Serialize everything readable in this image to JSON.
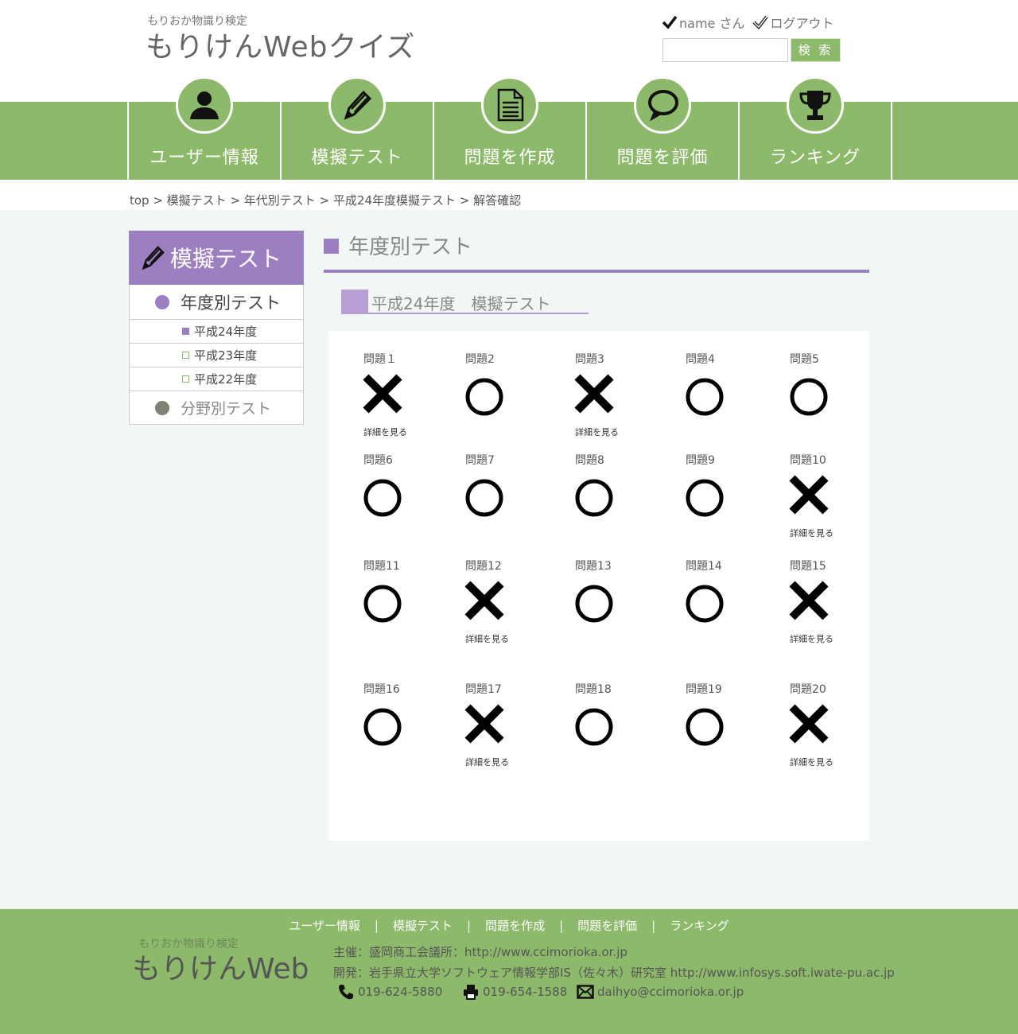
{
  "header": {
    "logo_sub": "もりおか物識り検定",
    "logo_main": "もりけんWebクイズ",
    "user_name": "name さん",
    "logout": "ログアウト",
    "search_placeholder": "",
    "search_button": "検 索"
  },
  "nav": [
    {
      "label": "ユーザー情報",
      "icon": "user-icon"
    },
    {
      "label": "模擬テスト",
      "icon": "pencil-icon"
    },
    {
      "label": "問題を作成",
      "icon": "document-icon"
    },
    {
      "label": "問題を評価",
      "icon": "speech-bubble-icon"
    },
    {
      "label": "ランキング",
      "icon": "trophy-icon"
    }
  ],
  "breadcrumb": "top > 模擬テスト > 年代別テスト > 平成24年度模擬テスト > 解答確認",
  "sidebar": {
    "heading": "模擬テスト",
    "category1": "年度別テスト",
    "years": [
      "平成24年度",
      "平成23年度",
      "平成22年度"
    ],
    "category2": "分野別テスト"
  },
  "main": {
    "title": "年度別テスト",
    "subtitle": "平成24年度　模擬テスト",
    "detail_label": "詳細を見る",
    "results": [
      {
        "label": "問題１",
        "correct": false
      },
      {
        "label": "問題2",
        "correct": true
      },
      {
        "label": "問題3",
        "correct": false
      },
      {
        "label": "問題4",
        "correct": true
      },
      {
        "label": "問題5",
        "correct": true
      },
      {
        "label": "問題6",
        "correct": true
      },
      {
        "label": "問題7",
        "correct": true
      },
      {
        "label": "問題8",
        "correct": true
      },
      {
        "label": "問題9",
        "correct": true
      },
      {
        "label": "問題10",
        "correct": false
      },
      {
        "label": "問題11",
        "correct": true
      },
      {
        "label": "問題12",
        "correct": false
      },
      {
        "label": "問題13",
        "correct": true
      },
      {
        "label": "問題14",
        "correct": true
      },
      {
        "label": "問題15",
        "correct": false
      },
      {
        "label": "問題16",
        "correct": true
      },
      {
        "label": "問題17",
        "correct": false
      },
      {
        "label": "問題18",
        "correct": true
      },
      {
        "label": "問題19",
        "correct": true
      },
      {
        "label": "問題20",
        "correct": false
      }
    ]
  },
  "footer": {
    "nav": [
      "ユーザー情報",
      "模擬テスト",
      "問題を作成",
      "問題を評価",
      "ランキング"
    ],
    "logo_sub": "もりおか物識り検定",
    "logo": "もりけんWeb",
    "host": "主催：盛岡商工会議所：http://www.ccimorioka.or.jp",
    "dev": "開発：岩手県立大学ソフトウェア情報学部IS（佐々木）研究室  http://www.infosys.soft.iwate-pu.ac.jp",
    "phone": "019-624-5880",
    "fax": "019-654-1588",
    "email": "daihyo@ccimorioka.or.jp"
  },
  "colors": {
    "green": "#8db96b",
    "purple": "#9c7fc0",
    "light_purple": "#b79ed4",
    "background": "#f1f7f5"
  }
}
